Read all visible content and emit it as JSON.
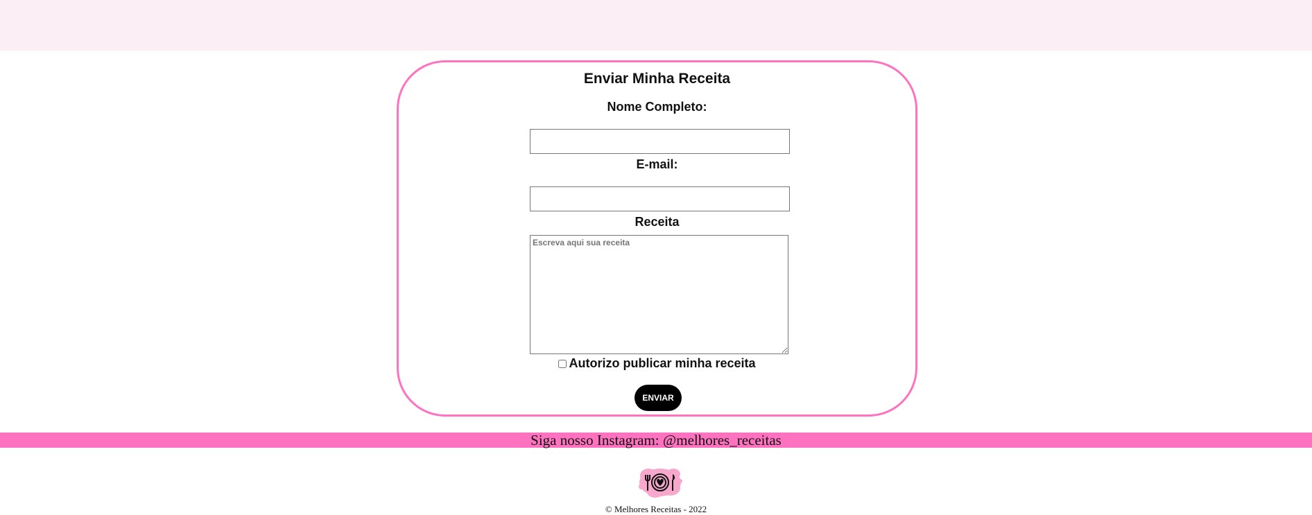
{
  "form": {
    "title": "Enviar Minha Receita",
    "name_label": "Nome Completo:",
    "name_value": "",
    "email_label": "E-mail:",
    "email_value": "",
    "recipe_label": "Receita",
    "recipe_placeholder": "Escreva aqui sua receita",
    "consent_label": "Autorizo publicar minha receita",
    "consent_checked": false,
    "submit_label": "ENVIAR"
  },
  "footer": {
    "instagram_text": "Siga nosso Instagram: @melhores_receitas",
    "logo_icon": "plate-fork-knife-heart-icon",
    "copyright": "© Melhores Receitas - 2022"
  },
  "colors": {
    "accent_pink": "#ff72bf",
    "topbar_bg": "#fbeff5",
    "button_bg": "#000000",
    "logo_splash": "#f7a8cc"
  }
}
